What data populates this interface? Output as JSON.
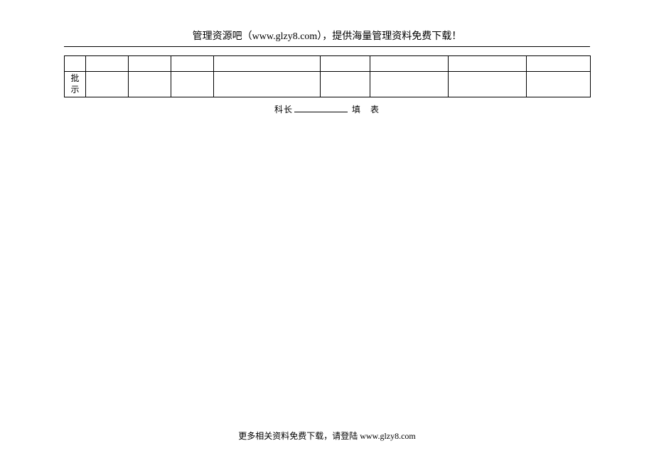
{
  "header": {
    "title": "管理资源吧（www.glzy8.com），提供海量管理资料免费下载！"
  },
  "table": {
    "row2_label": "批\n示"
  },
  "signature": {
    "label_left": "科长",
    "label_right": "填　表"
  },
  "footer": {
    "text": "更多相关资料免费下载，请登陆 www.glzy8.com"
  }
}
